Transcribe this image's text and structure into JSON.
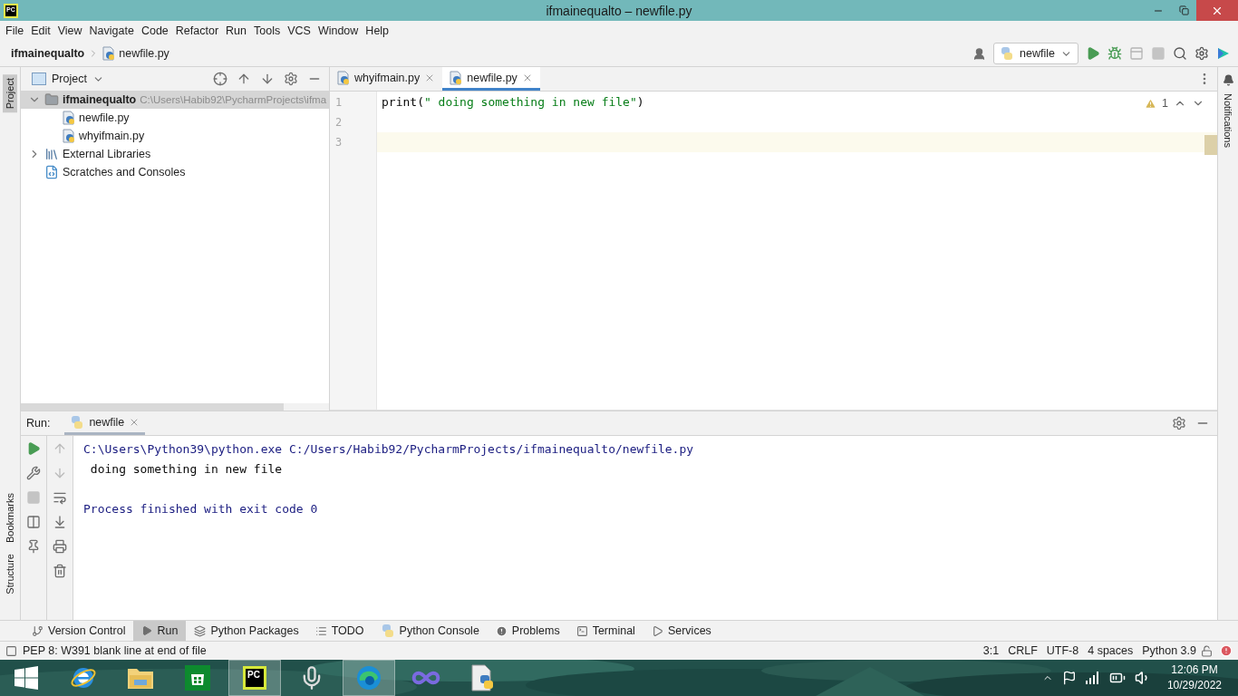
{
  "window": {
    "title": "ifmainequalto – newfile.py",
    "logo": "PC"
  },
  "menu": [
    "File",
    "Edit",
    "View",
    "Navigate",
    "Code",
    "Refactor",
    "Run",
    "Tools",
    "VCS",
    "Window",
    "Help"
  ],
  "breadcrumb": [
    {
      "label": "ifmainequalto",
      "kind": "project"
    },
    {
      "label": "newfile.py",
      "kind": "python"
    }
  ],
  "run_config": {
    "label": "newfile"
  },
  "left_strip": [
    {
      "label": "Project",
      "selected": true
    },
    {
      "label": "Bookmarks",
      "selected": false
    },
    {
      "label": "Structure",
      "selected": false
    }
  ],
  "right_strip": [
    {
      "label": "Notifications"
    }
  ],
  "project_panel": {
    "title": "Project",
    "tree": [
      {
        "label": "ifmainequalto",
        "path": "C:\\Users\\Habib92\\PycharmProjects\\ifma",
        "kind": "folder",
        "expanded": true,
        "children": [
          {
            "label": "newfile.py",
            "kind": "python"
          },
          {
            "label": "whyifmain.py",
            "kind": "python"
          }
        ]
      },
      {
        "label": "External Libraries",
        "kind": "library",
        "expanded": false
      },
      {
        "label": "Scratches and Consoles",
        "kind": "scratch"
      }
    ]
  },
  "editor": {
    "tabs": [
      {
        "label": "whyifmain.py",
        "selected": false
      },
      {
        "label": "newfile.py",
        "selected": true
      }
    ],
    "warning_count": "1",
    "lines": [
      {
        "number": "1",
        "current": false,
        "segments": [
          {
            "text": "print(",
            "kind": "plain"
          },
          {
            "text": "\" doing something in new file\"",
            "kind": "string"
          },
          {
            "text": ")",
            "kind": "plain"
          }
        ]
      },
      {
        "number": "2",
        "current": false
      },
      {
        "number": "3",
        "current": true
      }
    ]
  },
  "run_panel": {
    "label": "Run:",
    "tab": "newfile",
    "console": [
      {
        "kind": "command",
        "text": "C:\\Users\\Python39\\python.exe C:/Users/Habib92/PycharmProjects/ifmainequalto/newfile.py"
      },
      {
        "kind": "output",
        "text": " doing something in new file"
      },
      {
        "kind": "blank"
      },
      {
        "kind": "exit",
        "text": "Process finished with exit code 0"
      }
    ]
  },
  "tool_windows": [
    {
      "label": "Version Control",
      "kind": "vcs",
      "selected": false
    },
    {
      "label": "Run",
      "kind": "run",
      "selected": true
    },
    {
      "label": "Python Packages",
      "kind": "packages",
      "selected": false
    },
    {
      "label": "TODO",
      "kind": "todo",
      "selected": false
    },
    {
      "label": "Python Console",
      "kind": "console",
      "selected": false
    },
    {
      "label": "Problems",
      "kind": "problems",
      "selected": false
    },
    {
      "label": "Terminal",
      "kind": "terminal",
      "selected": false
    },
    {
      "label": "Services",
      "kind": "services",
      "selected": false
    }
  ],
  "status_bar": {
    "message": "PEP 8: W391 blank line at end of file",
    "items": [
      "3:1",
      "CRLF",
      "UTF-8",
      "4 spaces",
      "Python 3.9"
    ]
  },
  "taskbar": {
    "apps": [
      {
        "kind": "start",
        "selected": false
      },
      {
        "kind": "browser",
        "selected": false
      },
      {
        "kind": "files",
        "selected": false
      },
      {
        "kind": "store",
        "selected": false
      },
      {
        "kind": "ide",
        "selected": true,
        "badge": "PC"
      },
      {
        "kind": "microphone",
        "selected": false
      },
      {
        "kind": "edge",
        "selected": true
      },
      {
        "kind": "infinity",
        "selected": false
      },
      {
        "kind": "script",
        "selected": false
      }
    ],
    "time": "12:06 PM",
    "date": "10/29/2022"
  }
}
